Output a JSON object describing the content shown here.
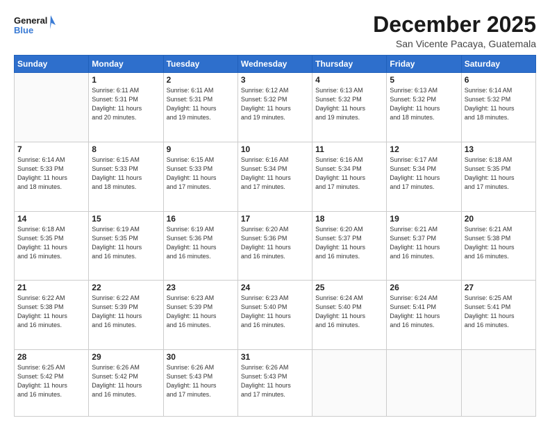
{
  "header": {
    "logo_line1": "General",
    "logo_line2": "Blue",
    "month": "December 2025",
    "location": "San Vicente Pacaya, Guatemala"
  },
  "days_of_week": [
    "Sunday",
    "Monday",
    "Tuesday",
    "Wednesday",
    "Thursday",
    "Friday",
    "Saturday"
  ],
  "weeks": [
    [
      {
        "day": "",
        "info": ""
      },
      {
        "day": "1",
        "info": "Sunrise: 6:11 AM\nSunset: 5:31 PM\nDaylight: 11 hours\nand 20 minutes."
      },
      {
        "day": "2",
        "info": "Sunrise: 6:11 AM\nSunset: 5:31 PM\nDaylight: 11 hours\nand 19 minutes."
      },
      {
        "day": "3",
        "info": "Sunrise: 6:12 AM\nSunset: 5:32 PM\nDaylight: 11 hours\nand 19 minutes."
      },
      {
        "day": "4",
        "info": "Sunrise: 6:13 AM\nSunset: 5:32 PM\nDaylight: 11 hours\nand 19 minutes."
      },
      {
        "day": "5",
        "info": "Sunrise: 6:13 AM\nSunset: 5:32 PM\nDaylight: 11 hours\nand 18 minutes."
      },
      {
        "day": "6",
        "info": "Sunrise: 6:14 AM\nSunset: 5:32 PM\nDaylight: 11 hours\nand 18 minutes."
      }
    ],
    [
      {
        "day": "7",
        "info": "Sunrise: 6:14 AM\nSunset: 5:33 PM\nDaylight: 11 hours\nand 18 minutes."
      },
      {
        "day": "8",
        "info": "Sunrise: 6:15 AM\nSunset: 5:33 PM\nDaylight: 11 hours\nand 18 minutes."
      },
      {
        "day": "9",
        "info": "Sunrise: 6:15 AM\nSunset: 5:33 PM\nDaylight: 11 hours\nand 17 minutes."
      },
      {
        "day": "10",
        "info": "Sunrise: 6:16 AM\nSunset: 5:34 PM\nDaylight: 11 hours\nand 17 minutes."
      },
      {
        "day": "11",
        "info": "Sunrise: 6:16 AM\nSunset: 5:34 PM\nDaylight: 11 hours\nand 17 minutes."
      },
      {
        "day": "12",
        "info": "Sunrise: 6:17 AM\nSunset: 5:34 PM\nDaylight: 11 hours\nand 17 minutes."
      },
      {
        "day": "13",
        "info": "Sunrise: 6:18 AM\nSunset: 5:35 PM\nDaylight: 11 hours\nand 17 minutes."
      }
    ],
    [
      {
        "day": "14",
        "info": "Sunrise: 6:18 AM\nSunset: 5:35 PM\nDaylight: 11 hours\nand 16 minutes."
      },
      {
        "day": "15",
        "info": "Sunrise: 6:19 AM\nSunset: 5:35 PM\nDaylight: 11 hours\nand 16 minutes."
      },
      {
        "day": "16",
        "info": "Sunrise: 6:19 AM\nSunset: 5:36 PM\nDaylight: 11 hours\nand 16 minutes."
      },
      {
        "day": "17",
        "info": "Sunrise: 6:20 AM\nSunset: 5:36 PM\nDaylight: 11 hours\nand 16 minutes."
      },
      {
        "day": "18",
        "info": "Sunrise: 6:20 AM\nSunset: 5:37 PM\nDaylight: 11 hours\nand 16 minutes."
      },
      {
        "day": "19",
        "info": "Sunrise: 6:21 AM\nSunset: 5:37 PM\nDaylight: 11 hours\nand 16 minutes."
      },
      {
        "day": "20",
        "info": "Sunrise: 6:21 AM\nSunset: 5:38 PM\nDaylight: 11 hours\nand 16 minutes."
      }
    ],
    [
      {
        "day": "21",
        "info": "Sunrise: 6:22 AM\nSunset: 5:38 PM\nDaylight: 11 hours\nand 16 minutes."
      },
      {
        "day": "22",
        "info": "Sunrise: 6:22 AM\nSunset: 5:39 PM\nDaylight: 11 hours\nand 16 minutes."
      },
      {
        "day": "23",
        "info": "Sunrise: 6:23 AM\nSunset: 5:39 PM\nDaylight: 11 hours\nand 16 minutes."
      },
      {
        "day": "24",
        "info": "Sunrise: 6:23 AM\nSunset: 5:40 PM\nDaylight: 11 hours\nand 16 minutes."
      },
      {
        "day": "25",
        "info": "Sunrise: 6:24 AM\nSunset: 5:40 PM\nDaylight: 11 hours\nand 16 minutes."
      },
      {
        "day": "26",
        "info": "Sunrise: 6:24 AM\nSunset: 5:41 PM\nDaylight: 11 hours\nand 16 minutes."
      },
      {
        "day": "27",
        "info": "Sunrise: 6:25 AM\nSunset: 5:41 PM\nDaylight: 11 hours\nand 16 minutes."
      }
    ],
    [
      {
        "day": "28",
        "info": "Sunrise: 6:25 AM\nSunset: 5:42 PM\nDaylight: 11 hours\nand 16 minutes."
      },
      {
        "day": "29",
        "info": "Sunrise: 6:26 AM\nSunset: 5:42 PM\nDaylight: 11 hours\nand 16 minutes."
      },
      {
        "day": "30",
        "info": "Sunrise: 6:26 AM\nSunset: 5:43 PM\nDaylight: 11 hours\nand 17 minutes."
      },
      {
        "day": "31",
        "info": "Sunrise: 6:26 AM\nSunset: 5:43 PM\nDaylight: 11 hours\nand 17 minutes."
      },
      {
        "day": "",
        "info": ""
      },
      {
        "day": "",
        "info": ""
      },
      {
        "day": "",
        "info": ""
      }
    ]
  ]
}
